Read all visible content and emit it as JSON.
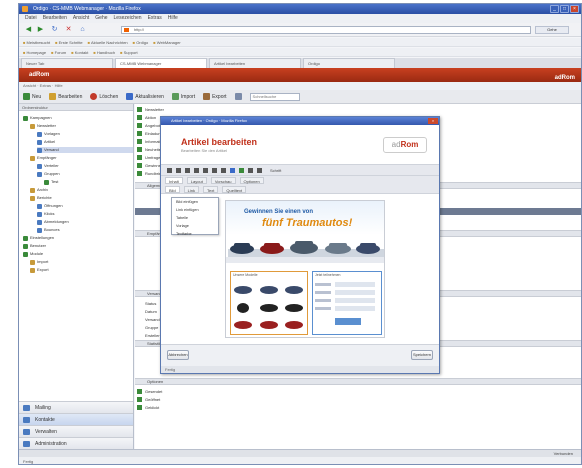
{
  "window": {
    "title": "Ordigo · CS-MMB Webmanager · Mozilla Firefox"
  },
  "menubar": {
    "items": [
      "Datei",
      "Bearbeiten",
      "Ansicht",
      "Gehe",
      "Lesezeichen",
      "Extras",
      "Hilfe"
    ]
  },
  "navbar": {
    "url": "http://",
    "go_label": "Gehe"
  },
  "bookmarks": {
    "row1": [
      "Meistbesucht",
      "Erste Schritte",
      "Aktuelle Nachrichten",
      "Ordigo",
      "WebManager"
    ],
    "row2": [
      "Homepage",
      "Forum",
      "Kontakt",
      "Handbuch",
      "Support"
    ]
  },
  "tabs": [
    {
      "label": "Neuer Tab",
      "active": false
    },
    {
      "label": "CS-MMB Webmanager",
      "active": true
    },
    {
      "label": "Artikel bearbeiten",
      "active": false
    },
    {
      "label": "Ordigo",
      "active": false
    }
  ],
  "app": {
    "title": "adRom",
    "logo": "adRom",
    "subbar": "Ansicht · Extras · Hilfe"
  },
  "toolbar": {
    "new_label": "Neu",
    "edit_label": "Bearbeiten",
    "delete_label": "Löschen",
    "refresh_label": "Aktualisieren",
    "import_label": "Import",
    "export_label": "Export",
    "search_placeholder": "Schnellsuche"
  },
  "sidebar": {
    "header": "Ordnerstruktur",
    "tree": [
      {
        "label": "Kampagnen",
        "level": 0,
        "selected": false
      },
      {
        "label": "Newsletter",
        "level": 1,
        "selected": false
      },
      {
        "label": "Vorlagen",
        "level": 2,
        "selected": false
      },
      {
        "label": "Artikel",
        "level": 2,
        "selected": false
      },
      {
        "label": "Versand",
        "level": 2,
        "selected": true
      },
      {
        "label": "Empfänger",
        "level": 1,
        "selected": false
      },
      {
        "label": "Verteiler",
        "level": 2,
        "selected": false
      },
      {
        "label": "Gruppen",
        "level": 2,
        "selected": false
      },
      {
        "label": "Test",
        "level": 3,
        "selected": false
      },
      {
        "label": "Archiv",
        "level": 1,
        "selected": false
      },
      {
        "label": "Berichte",
        "level": 1,
        "selected": false
      },
      {
        "label": "Öffnungen",
        "level": 2,
        "selected": false
      },
      {
        "label": "Klicks",
        "level": 2,
        "selected": false
      },
      {
        "label": "Abmeldungen",
        "level": 2,
        "selected": false
      },
      {
        "label": "Bounces",
        "level": 2,
        "selected": false
      },
      {
        "label": "Einstellungen",
        "level": 0,
        "selected": false
      },
      {
        "label": "Benutzer",
        "level": 0,
        "selected": false
      },
      {
        "label": "Module",
        "level": 0,
        "selected": false
      },
      {
        "label": "Import",
        "level": 1,
        "selected": false
      },
      {
        "label": "Export",
        "level": 1,
        "selected": false
      }
    ],
    "nav": [
      {
        "label": "Mailing",
        "active": false
      },
      {
        "label": "Kontakte",
        "active": true
      },
      {
        "label": "Verwalten",
        "active": false
      },
      {
        "label": "Administration",
        "active": false
      }
    ]
  },
  "list": {
    "rows_top": [
      "Newsletter",
      "Aktion",
      "Angebot",
      "Einladung",
      "Information",
      "Neuheiten",
      "Umfrage",
      "Gewinnspiel",
      "Rundbrief"
    ],
    "sections": [
      {
        "label": "Allgemein"
      },
      {
        "label": "Empfänger"
      },
      {
        "label": "Versand"
      },
      {
        "label": "Statistik"
      },
      {
        "label": "Optionen"
      }
    ],
    "rows_mid": [
      "Status",
      "Datum",
      "Versand",
      "Gruppe",
      "Ersteller"
    ],
    "rows_bottom": [
      "Gesendet",
      "Geöffnet",
      "Geklickt"
    ]
  },
  "dialog": {
    "title": "Artikel bearbeiten · Ordigo · Mozilla Firefox",
    "heading": "Artikel bearbeiten",
    "subheading": "Bearbeiten Sie den Artikel",
    "logo_main": "ad",
    "logo_accent": "Rom",
    "format_label": "Schrift",
    "tabs": [
      "Inhalt",
      "Layout",
      "Vorschau",
      "Optionen"
    ],
    "subtabs": [
      "Bild",
      "Link",
      "Text",
      "Quelltext"
    ],
    "dropdown_items": [
      "Bild einfügen",
      "Link einfügen",
      "Tabelle",
      "Vorlage",
      "Textfarbe"
    ],
    "ad": {
      "line1": "Gewinnen Sie einen von",
      "line2": "fünf Traumautos!",
      "left_box_title": "Unsere Modelle",
      "right_box_title": "Jetzt teilnehmen"
    },
    "cancel_label": "Abbrechen",
    "save_label": "Speichern",
    "status": "Fertig"
  },
  "statusbar": {
    "left": "",
    "right": "Verbunden"
  },
  "browser_status": "Fertig",
  "colors": {
    "accent_red": "#c1301a",
    "title_blue": "#3558ae",
    "ad_orange": "#e08a10"
  }
}
